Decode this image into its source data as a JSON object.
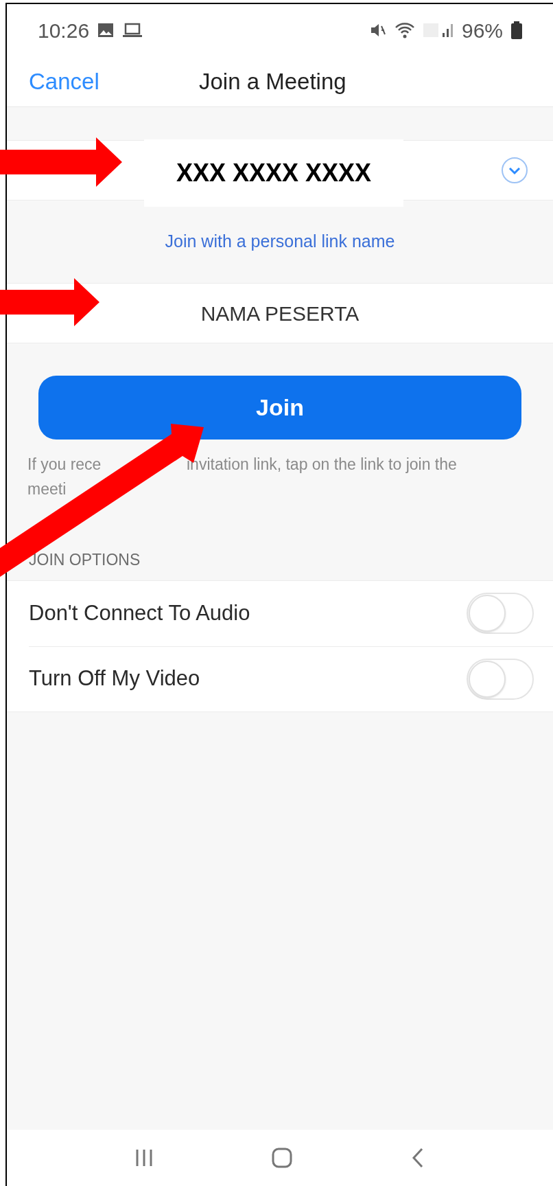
{
  "status_bar": {
    "time": "10:26",
    "battery": "96%"
  },
  "header": {
    "cancel": "Cancel",
    "title": "Join a Meeting"
  },
  "meeting_id": {
    "value": "XXX XXXX XXXX"
  },
  "personal_link": "Join with a personal link name",
  "name_field": {
    "value": "NAMA PESERTA"
  },
  "join_button": "Join",
  "help_text": [
    "If you rece",
    "invitation link, tap on the link to join the",
    "meeti"
  ],
  "join_options": {
    "title": "JOIN OPTIONS",
    "options": [
      {
        "label": "Don't Connect To Audio",
        "on": false
      },
      {
        "label": "Turn Off My Video",
        "on": false
      }
    ]
  }
}
